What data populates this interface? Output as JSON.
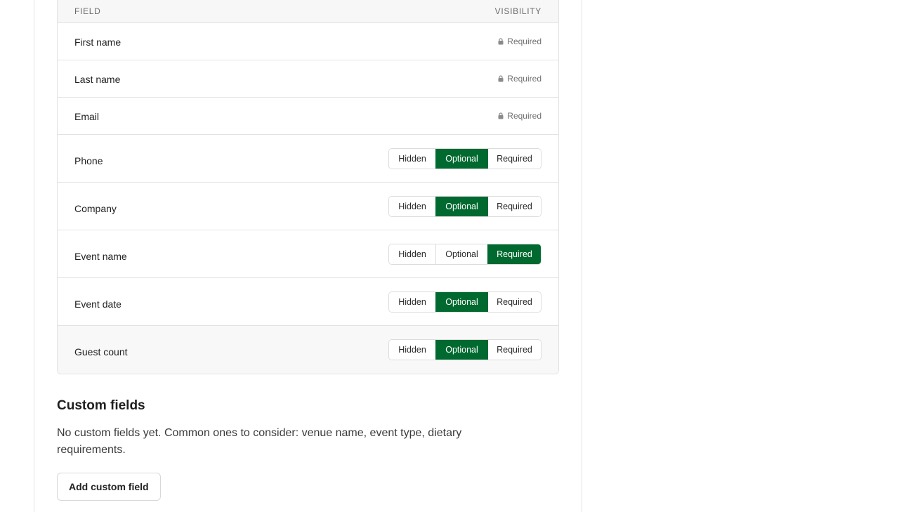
{
  "table": {
    "header_field": "FIELD",
    "header_visibility": "VISIBILITY",
    "locked_rows": [
      {
        "name": "First name",
        "status": "Required"
      },
      {
        "name": "Last name",
        "status": "Required"
      },
      {
        "name": "Email",
        "status": "Required"
      }
    ],
    "option_labels": {
      "hidden": "Hidden",
      "optional": "Optional",
      "required": "Required"
    },
    "toggle_rows": [
      {
        "name": "Phone",
        "selected": "optional"
      },
      {
        "name": "Company",
        "selected": "optional"
      },
      {
        "name": "Event name",
        "selected": "required"
      },
      {
        "name": "Event date",
        "selected": "optional"
      },
      {
        "name": "Guest count",
        "selected": "optional"
      }
    ]
  },
  "custom": {
    "title": "Custom fields",
    "description": "No custom fields yet. Common ones to consider: venue name, event type, dietary requirements.",
    "add_button": "Add custom field"
  },
  "colors": {
    "accent": "#00692f"
  },
  "icons": {
    "locked": "lock-icon"
  }
}
